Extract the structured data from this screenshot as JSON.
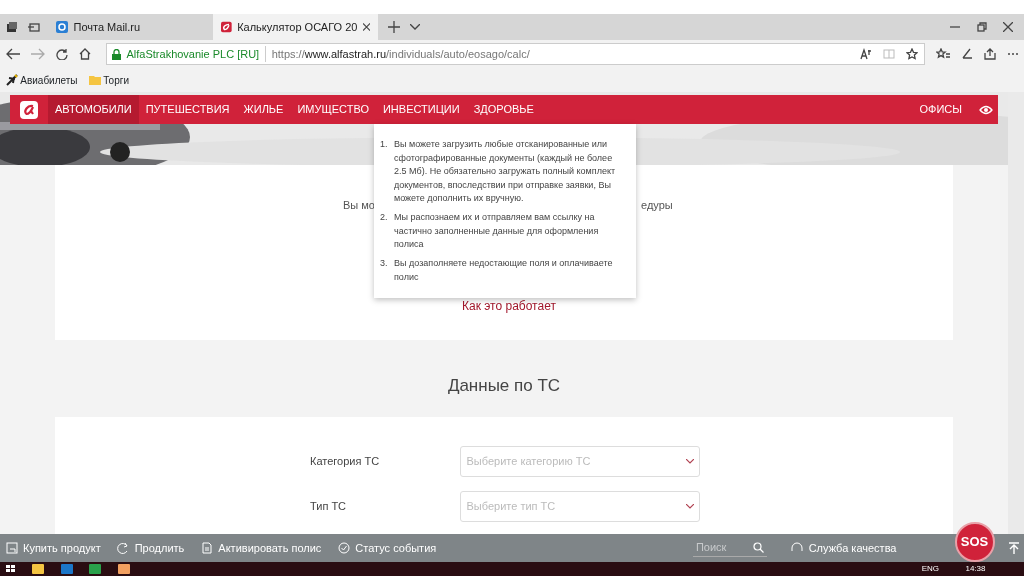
{
  "browser": {
    "tabs": [
      {
        "title": "Почта Mail.ru",
        "selected": false
      },
      {
        "title": "Калькулятор ОСАГО 20",
        "selected": true
      }
    ],
    "address": {
      "site": "AlfaStrakhovanie PLC [RU]",
      "url_prefix": "https://",
      "url_host": "www.alfastrah.ru",
      "url_path": "/individuals/auto/eosago/calc/"
    },
    "bookmarks": [
      {
        "label": "Авиабилеты",
        "kind": "plane"
      },
      {
        "label": "Торги",
        "kind": "folder"
      }
    ]
  },
  "site_nav": {
    "items": [
      {
        "label": "АВТОМОБИЛИ",
        "selected": true
      },
      {
        "label": "ПУТЕШЕСТВИЯ",
        "selected": false
      },
      {
        "label": "ЖИЛЬЕ",
        "selected": false
      },
      {
        "label": "ИМУЩЕСТВО",
        "selected": false
      },
      {
        "label": "ИНВЕСТИЦИИ",
        "selected": false
      },
      {
        "label": "ЗДОРОВЬЕ",
        "selected": false
      }
    ],
    "offices": "ОФИСЫ"
  },
  "upload_card": {
    "text_left": "Вы мо",
    "text_right": "едуры",
    "link": "Как это работает"
  },
  "tooltip": {
    "steps": [
      {
        "number": "1.",
        "text": "Вы можете загрузить любые отсканированные или сфотографированные документы (каждый не более 2.5 Мб). Не обязательно загружать полный комплект документов, впоследствии при отправке заявки, Вы можете дополнить их вручную."
      },
      {
        "number": "2.",
        "text": "Мы распознаем их и отправляем вам ссылку на частично заполненные данные для оформления полиса"
      },
      {
        "number": "3.",
        "text": "Вы дозаполняете недостающие поля и оплачиваете полис"
      }
    ]
  },
  "vehicle_section": {
    "title": "Данные по ТС",
    "fields": [
      {
        "label": "Категория ТС",
        "placeholder": "Выберите категорию ТС"
      },
      {
        "label": "Тип ТС",
        "placeholder": "Выберите тип ТС"
      }
    ]
  },
  "bottom_bar": {
    "actions": [
      {
        "label": "Купить продукт",
        "kind": "cart"
      },
      {
        "label": "Продлить",
        "kind": "renew"
      },
      {
        "label": "Активировать полис",
        "kind": "doc"
      },
      {
        "label": "Статус события",
        "kind": "check"
      }
    ],
    "search_placeholder": "Поиск",
    "quality": "Служба качества",
    "sos": "SOS"
  },
  "taskbar": {
    "lang": "ENG",
    "time": "14:38"
  }
}
